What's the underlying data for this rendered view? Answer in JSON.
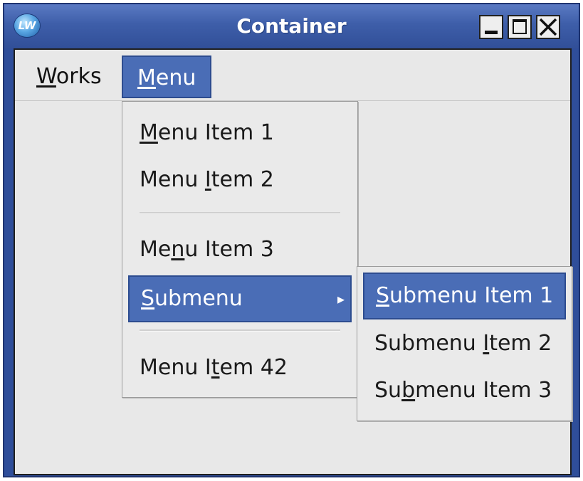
{
  "window": {
    "title": "Container",
    "icon": "lw-app-icon",
    "icon_text": "LW",
    "controls": [
      "minimize-icon",
      "maximize-icon",
      "close-icon"
    ]
  },
  "menubar": {
    "items": [
      {
        "pre": "",
        "mn": "W",
        "post": "orks"
      },
      {
        "pre": "",
        "mn": "M",
        "post": "enu"
      }
    ]
  },
  "menu": {
    "items": [
      {
        "pre": "",
        "mn": "M",
        "post": "enu Item 1"
      },
      {
        "pre": "Menu ",
        "mn": "I",
        "post": "tem 2"
      },
      {
        "pre": "Me",
        "mn": "n",
        "post": "u Item 3"
      },
      {
        "pre": "",
        "mn": "S",
        "post": "ubmenu",
        "submenu_arrow": "chevron-right-icon"
      },
      {
        "pre": "Menu I",
        "mn": "t",
        "post": "em 42"
      }
    ]
  },
  "submenu": {
    "items": [
      {
        "pre": "",
        "mn": "S",
        "post": "ubmenu Item 1"
      },
      {
        "pre": "Submenu ",
        "mn": "I",
        "post": "tem 2"
      },
      {
        "pre": "Su",
        "mn": "b",
        "post": "menu Item 3"
      }
    ]
  },
  "colors": {
    "titlebar": "#3e5ea9",
    "highlight": "#4a6db6",
    "client_bg": "#e8e8e8"
  }
}
